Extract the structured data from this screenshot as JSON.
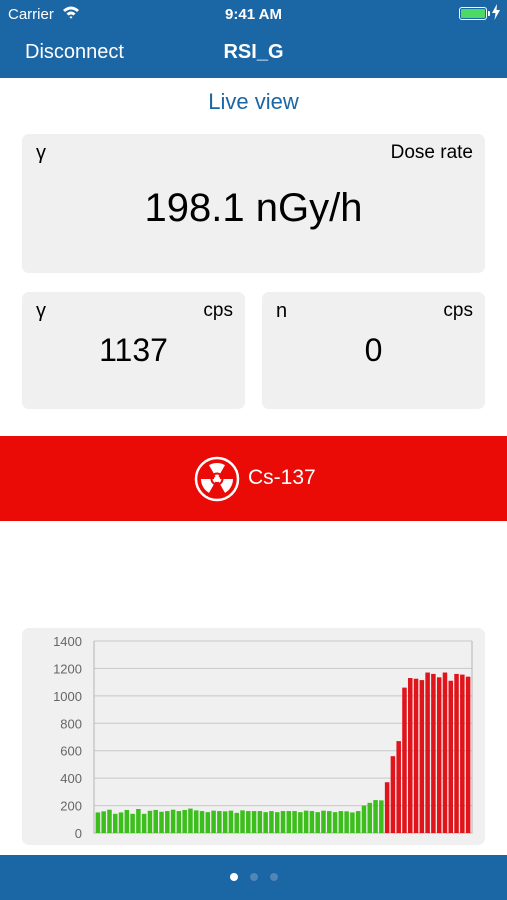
{
  "status_bar": {
    "carrier": "Carrier",
    "time": "9:41 AM",
    "battery_color": "#4cd964"
  },
  "nav": {
    "back_label": "Disconnect",
    "title": "RSI_G"
  },
  "section_title": "Live view",
  "dose_card": {
    "symbol": "γ",
    "label": "Dose rate",
    "value": "198.1 nGy/h"
  },
  "gamma_card": {
    "symbol": "γ",
    "unit": "cps",
    "value": "1137"
  },
  "neutron_card": {
    "symbol": "n",
    "unit": "cps",
    "value": "0"
  },
  "alarm": {
    "isotope": "Cs-137",
    "icon": "radiation-icon",
    "color": "#ea0b06"
  },
  "page_control": {
    "pages": 3,
    "current": 0
  },
  "colors": {
    "brand": "#1b66a5",
    "card_bg": "#f0f0f0",
    "normal_bar": "#3cbf1c",
    "alarm_bar": "#e0141b"
  },
  "chart_data": {
    "type": "bar",
    "title": "",
    "xlabel": "",
    "ylabel": "",
    "ylim": [
      0,
      1400
    ],
    "yticks": [
      0,
      200,
      400,
      600,
      800,
      1000,
      1200,
      1400
    ],
    "grid": true,
    "series": [
      {
        "color": "#3cbf1c",
        "start_index": 0,
        "values": [
          150,
          158,
          170,
          140,
          150,
          168,
          140,
          175,
          140,
          162,
          168,
          155,
          160,
          170,
          160,
          168,
          178,
          165,
          160,
          152,
          163,
          160,
          158,
          163,
          147,
          165,
          160,
          160,
          160,
          152,
          160,
          152,
          160,
          160,
          160,
          152,
          163,
          160,
          152,
          163,
          160,
          152,
          160,
          158,
          150,
          160,
          200,
          220,
          240,
          238
        ]
      },
      {
        "color": "#e0141b",
        "start_index": 50,
        "values": [
          370,
          560,
          670,
          1060,
          1130,
          1125,
          1115,
          1170,
          1160,
          1135,
          1170,
          1110,
          1160,
          1155,
          1140
        ]
      }
    ]
  }
}
